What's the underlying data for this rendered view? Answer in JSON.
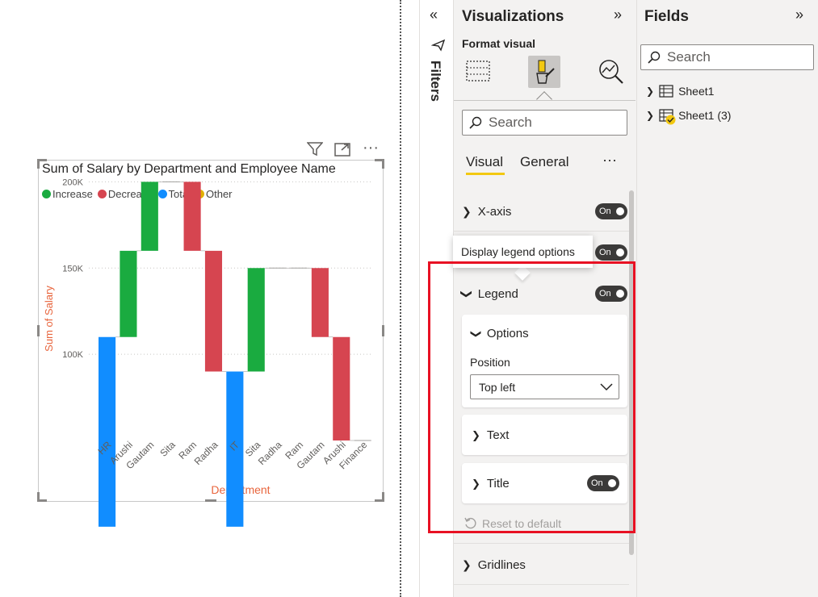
{
  "report": {
    "visual_header_icons": [
      "filter-icon",
      "focus-mode-icon",
      "more-options-icon"
    ]
  },
  "chart_data": {
    "type": "waterfall",
    "title": "Sum of Salary by Department and Employee Name",
    "xlabel": "Department",
    "ylabel": "Sum of Salary",
    "ylim": [
      50000,
      210000
    ],
    "yticks": [
      "100K",
      "150K",
      "200K"
    ],
    "ytick_values": [
      100000,
      150000,
      200000
    ],
    "legend_position": "top-left",
    "legend": [
      {
        "label": "Increase",
        "color": "#1aab40"
      },
      {
        "label": "Decrease",
        "color": "#d64550"
      },
      {
        "label": "Total",
        "color": "#118dff"
      },
      {
        "label": "Other",
        "color": "#e1b100"
      }
    ],
    "categories": [
      "HR",
      "Arushi",
      "Gautam",
      "Sita",
      "Ram",
      "Radha",
      "IT",
      "Sita",
      "Radha",
      "Ram",
      "Gautam",
      "Arushi",
      "Finance"
    ],
    "bars": [
      {
        "kind": "Total",
        "start": 0,
        "end": 110000
      },
      {
        "kind": "Increase",
        "start": 110000,
        "end": 160000
      },
      {
        "kind": "Increase",
        "start": 160000,
        "end": 200000
      },
      {
        "kind": "Flat",
        "start": 200000,
        "end": 200000
      },
      {
        "kind": "Decrease",
        "start": 200000,
        "end": 160000
      },
      {
        "kind": "Decrease",
        "start": 160000,
        "end": 90000
      },
      {
        "kind": "Total",
        "start": 0,
        "end": 90000
      },
      {
        "kind": "Increase",
        "start": 90000,
        "end": 150000
      },
      {
        "kind": "Flat",
        "start": 150000,
        "end": 150000
      },
      {
        "kind": "Flat",
        "start": 150000,
        "end": 150000
      },
      {
        "kind": "Decrease",
        "start": 150000,
        "end": 110000
      },
      {
        "kind": "Decrease",
        "start": 110000,
        "end": 50000
      },
      {
        "kind": "Flat",
        "start": 50000,
        "end": 50000
      }
    ]
  },
  "filters": {
    "label": "Filters"
  },
  "visualizations": {
    "title": "Visualizations",
    "subtitle": "Format visual",
    "search_placeholder": "Search",
    "tabs": [
      "Visual",
      "General"
    ],
    "more": "···",
    "sections": {
      "x_axis": {
        "label": "X-axis",
        "toggle": "On"
      },
      "hidden_toggle": "On",
      "legend": {
        "label": "Legend",
        "toggle": "On"
      },
      "gridlines": {
        "label": "Gridlines"
      }
    },
    "tooltip": "Display legend options",
    "legend_options": {
      "options_label": "Options",
      "position_label": "Position",
      "position_value": "Top left",
      "text_label": "Text",
      "title_label": "Title",
      "title_toggle": "On",
      "reset_label": "Reset to default"
    }
  },
  "fields": {
    "title": "Fields",
    "search_placeholder": "Search",
    "tables": [
      {
        "name": "Sheet1"
      },
      {
        "name": "Sheet1 (3)"
      }
    ]
  },
  "colors": {
    "accent": "#f2c811",
    "highlight": "#e81123",
    "axis_title": "#e8653d"
  }
}
